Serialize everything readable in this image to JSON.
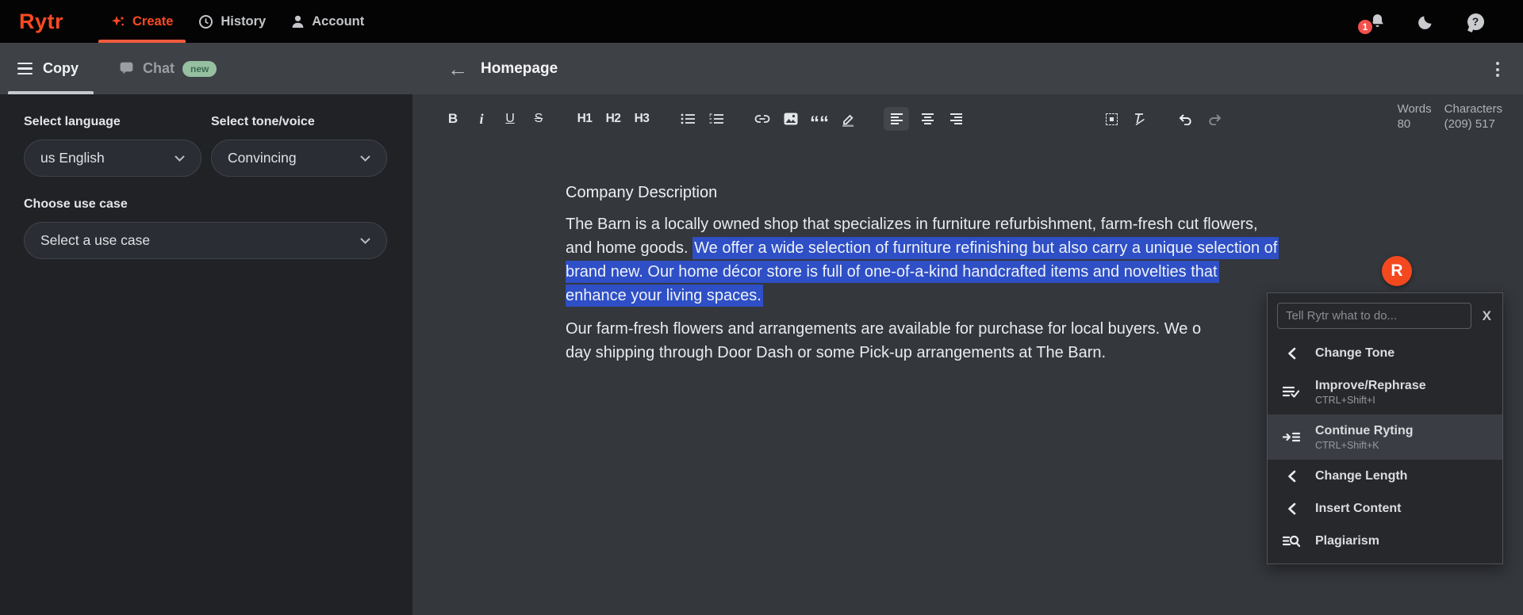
{
  "colors": {
    "accent": "#fb4a22",
    "selection_blue": "#2e4fc5",
    "notification_red": "#f4504b",
    "new_badge_green": "#97bfa1",
    "nav_black": "#040404",
    "panel_dark": "#26282c"
  },
  "nav": {
    "logo": "Rytr",
    "tabs": {
      "create": "Create",
      "history": "History",
      "account": "Account"
    },
    "notification_count": "1"
  },
  "sidebar": {
    "copy_tab": "Copy",
    "chat_tab": "Chat",
    "chat_badge": "new",
    "language": {
      "label": "Select language",
      "value": "us English"
    },
    "tone": {
      "label": "Select tone/voice",
      "value": "Convincing"
    },
    "use_case": {
      "label": "Choose use case",
      "value": "Select a use case"
    }
  },
  "editor": {
    "title": "Homepage",
    "toolbar": {
      "bold": "B",
      "italic": "i",
      "underline": "U",
      "strike": "S",
      "h1": "H1",
      "h2": "H2",
      "h3": "H3",
      "quote": "““"
    },
    "stats": {
      "words_label": "Words",
      "words_value": "80",
      "chars_label": "Characters",
      "chars_value": "(209) 517"
    },
    "document": {
      "heading": "Company Description",
      "p1_line1": "The Barn is a locally owned shop that specializes in furniture refurbishment, farm-fresh cut flowers,",
      "p1_line2_plain": "and home goods. ",
      "p1_line2_selected": "We offer a wide selection of furniture refinishing but also carry a unique selection of",
      "p1_line3_selected": "brand new. Our home décor store is full of one-of-a-kind handcrafted items and novelties that",
      "p1_line4_selected": "enhance your living spaces.",
      "p2_line1": "Our farm-fresh flowers and arrangements are available for purchase for local buyers. We o",
      "p2_line2": "day shipping through Door Dash or some Pick-up arrangements at The Barn."
    }
  },
  "assistant_menu": {
    "avatar_letter": "R",
    "input_placeholder": "Tell Rytr what to do...",
    "close_label": "X",
    "items": [
      {
        "label": "Change Tone",
        "shortcut": ""
      },
      {
        "label": "Improve/Rephrase",
        "shortcut": "CTRL+Shift+I"
      },
      {
        "label": "Continue Ryting",
        "shortcut": "CTRL+Shift+K"
      },
      {
        "label": "Change Length",
        "shortcut": ""
      },
      {
        "label": "Insert Content",
        "shortcut": ""
      },
      {
        "label": "Plagiarism",
        "shortcut": ""
      }
    ]
  }
}
